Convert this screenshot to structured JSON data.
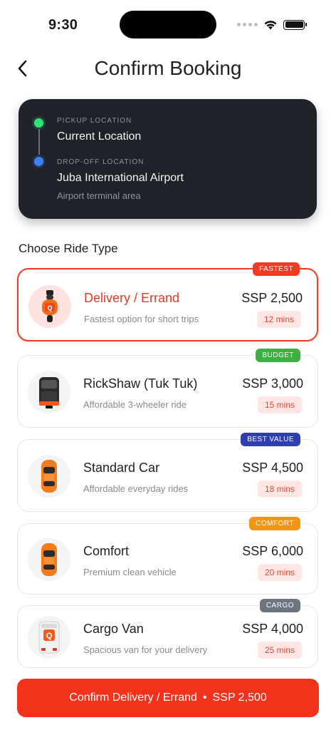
{
  "status_bar": {
    "time": "9:30"
  },
  "header": {
    "title": "Confirm Booking"
  },
  "locations": {
    "pickup_label": "PICKUP LOCATION",
    "pickup_value": "Current Location",
    "dropoff_label": "DROP-OFF LOCATION",
    "dropoff_value": "Juba International Airport",
    "dropoff_sub": "Airport terminal area"
  },
  "section_title": "Choose Ride Type",
  "rides": [
    {
      "name": "Delivery / Errand",
      "desc": "Fastest option for short trips",
      "price": "SSP 2,500",
      "eta": "12 mins",
      "badge": "FASTEST",
      "badge_color": "#f03a24",
      "icon": "delivery-scooter-icon",
      "selected": true
    },
    {
      "name": "RickShaw (Tuk Tuk)",
      "desc": "Affordable 3-wheeler ride",
      "price": "SSP 3,000",
      "eta": "15 mins",
      "badge": "BUDGET",
      "badge_color": "#3cb043",
      "icon": "tuk-tuk-icon",
      "selected": false
    },
    {
      "name": "Standard Car",
      "desc": "Affordable everyday rides",
      "price": "SSP 4,500",
      "eta": "18 mins",
      "badge": "BEST VALUE",
      "badge_color": "#2f3fb2",
      "icon": "car-icon",
      "selected": false
    },
    {
      "name": "Comfort",
      "desc": "Premium clean vehicle",
      "price": "SSP 6,000",
      "eta": "20 mins",
      "badge": "COMFORT",
      "badge_color": "#f39413",
      "icon": "comfort-car-icon",
      "selected": false
    },
    {
      "name": "Cargo Van",
      "desc": "Spacious van for your delivery",
      "price": "SSP 4,000",
      "eta": "25 mins",
      "badge": "CARGO",
      "badge_color": "#6b7682",
      "icon": "cargo-van-icon",
      "selected": false
    }
  ],
  "confirm": {
    "ride_name": "Confirm Delivery / Errand",
    "separator": "•",
    "price": "SSP 2,500"
  }
}
